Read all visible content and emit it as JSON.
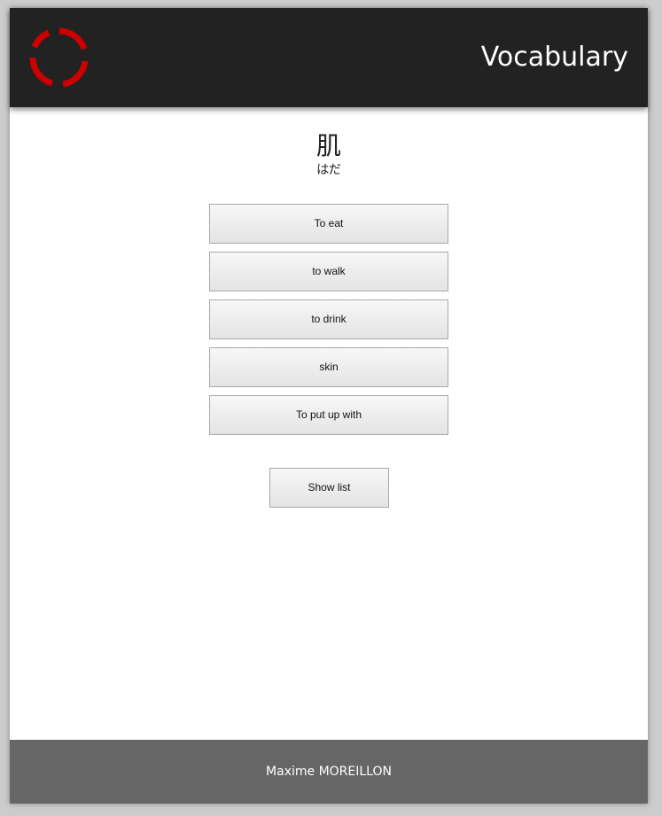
{
  "header": {
    "title": "Vocabulary",
    "logo_icon": "red-ring-logo-icon",
    "logo_color": "#cc0000"
  },
  "quiz": {
    "kanji": "肌",
    "reading": "はだ",
    "choices": [
      "To eat",
      "to walk",
      "to drink",
      "skin",
      "To put up with"
    ]
  },
  "actions": {
    "show_list_label": "Show list"
  },
  "footer": {
    "author": "Maxime MOREILLON"
  },
  "colors": {
    "header_bg": "#222222",
    "footer_bg": "#666666",
    "page_bg": "#cccccc"
  }
}
